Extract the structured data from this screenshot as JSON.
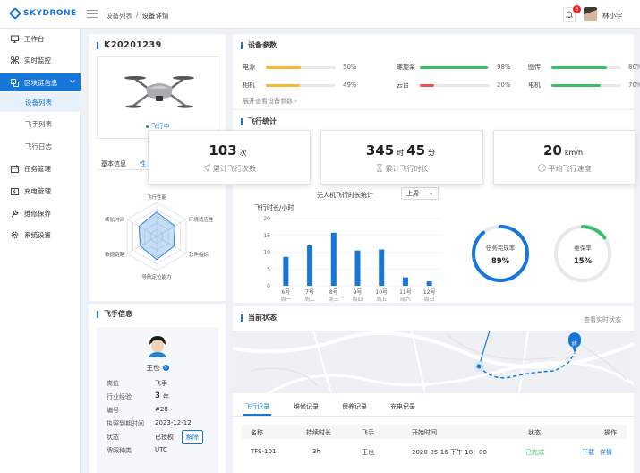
{
  "app": {
    "logo": "SKYDRONE",
    "username": "林小宇",
    "notify_count": "3"
  },
  "breadcrumb": [
    "设备列表",
    "设备详情"
  ],
  "sidebar": {
    "items": [
      {
        "label": "工作台",
        "icon": "monitor-icon"
      },
      {
        "label": "实时监控",
        "icon": "drone-icon"
      },
      {
        "label": "区块链信息",
        "icon": "chain-icon"
      },
      {
        "label": "任务管理",
        "icon": "calendar-icon"
      },
      {
        "label": "充电管理",
        "icon": "charge-icon"
      },
      {
        "label": "维修保养",
        "icon": "wrench-icon"
      },
      {
        "label": "系统设置",
        "icon": "gear-icon"
      }
    ],
    "sub_items": [
      "设备列表",
      "飞手列表",
      "飞行日志"
    ]
  },
  "device": {
    "id": "K20201239",
    "status": "飞行中",
    "tabs": [
      "基本信息",
      "性"
    ]
  },
  "radar": {
    "labels": [
      "飞行性能",
      "环境适应性",
      "软件指标",
      "导航定位能力",
      "数据链路",
      "续航时间"
    ],
    "values": [
      0.72,
      0.62,
      0.58,
      0.68,
      0.55,
      0.6
    ]
  },
  "pilot": {
    "title": "飞手信息",
    "name": "王也",
    "rows": [
      {
        "key": "岗位",
        "value": "飞手"
      },
      {
        "key": "行业经验",
        "value": "3",
        "unit": "年"
      },
      {
        "key": "编号",
        "value": "#28"
      },
      {
        "key": "执照到期时间",
        "value": "2023-12-12"
      },
      {
        "key": "状态",
        "value": "已授权",
        "action": "解除"
      },
      {
        "key": "牌照种类",
        "value": "UTC"
      }
    ]
  },
  "params": {
    "title": "设备参数",
    "items": [
      {
        "label": "电源",
        "pct": "50%",
        "value": 0.5,
        "color": "#f5b83d"
      },
      {
        "label": "螺旋桨",
        "pct": "98%",
        "value": 0.98,
        "color": "#3cbf6a"
      },
      {
        "label": "图传",
        "pct": "80%",
        "value": 0.8,
        "color": "#3cbf6a"
      },
      {
        "label": "相机",
        "pct": "49%",
        "value": 0.49,
        "color": "#f5b83d"
      },
      {
        "label": "云台",
        "pct": "20%",
        "value": 0.2,
        "color": "#f0505a"
      },
      {
        "label": "电机",
        "pct": "70%",
        "value": 0.7,
        "color": "#3cbf6a"
      }
    ],
    "more": "展开查看设备参数"
  },
  "stats": {
    "title": "飞行统计",
    "cards": [
      {
        "num": "103",
        "unit": "次",
        "desc": "累计飞行次数",
        "icon": "send-icon"
      },
      {
        "num": "345",
        "unit": "时",
        "num2": "45",
        "unit2": "分",
        "desc": "累计飞行时长",
        "icon": "hourglass-icon"
      },
      {
        "num": "20",
        "unit": "km/h",
        "desc": "平均飞行速度",
        "icon": "speed-icon"
      }
    ]
  },
  "chart_data": {
    "type": "bar",
    "title": "无人机飞行时长统计",
    "ylabel": "飞行时长/小时",
    "ylim": [
      0,
      20
    ],
    "yticks": [
      "0",
      "5",
      "10",
      "15",
      "20"
    ],
    "categories": [
      "6号",
      "7号",
      "8号",
      "9号",
      "10号",
      "11号",
      "12号"
    ],
    "weekdays": [
      "周一",
      "周二",
      "周三",
      "周四",
      "周五",
      "周六",
      "周日"
    ],
    "values": [
      8.6,
      12,
      15.8,
      10.5,
      10.8,
      2.5,
      1.3
    ],
    "color": "#1677d9",
    "period": "上周"
  },
  "rings": [
    {
      "label": "任务完成率",
      "pct": "89%",
      "value": 0.89,
      "color": "#1677d9"
    },
    {
      "label": "维保率",
      "pct": "15%",
      "value": 0.15,
      "color": "#3cbf6a"
    }
  ],
  "current": {
    "title": "当前状态",
    "link": "查看实时状态",
    "marker": "终"
  },
  "records": {
    "tabs": [
      "飞行记录",
      "维修记录",
      "保养记录",
      "充电记录"
    ],
    "headers": [
      "名称",
      "持续时长",
      "飞手",
      "开始时间",
      "状态",
      "操作"
    ],
    "rows": [
      {
        "name": "TFS-101",
        "duration": "3h",
        "pilot": "王也",
        "start": "2020-05-16 下午 18：00",
        "status": "已完成",
        "actions": [
          "下载",
          "详情"
        ]
      }
    ]
  }
}
